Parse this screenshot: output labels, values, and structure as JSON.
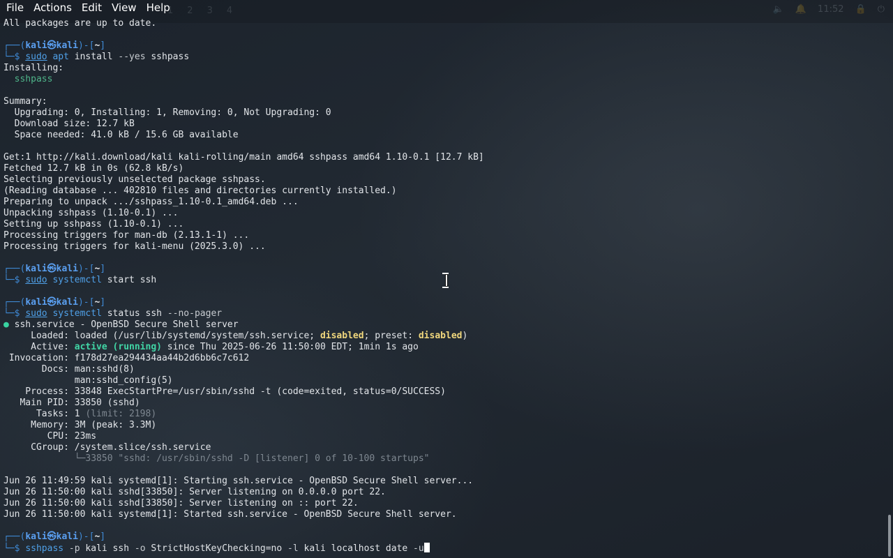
{
  "menu": [
    "File",
    "Actions",
    "Edit",
    "View",
    "Help"
  ],
  "panel": {
    "workspaces": [
      "1",
      "2",
      "3",
      "4"
    ],
    "clock": "11:52"
  },
  "prompt": {
    "user": "kali",
    "host": "kali",
    "dir": "~",
    "at": "㉿"
  },
  "lines": [
    "All packages are up to date.",
    "",
    "Installing:",
    "  sshpass",
    "",
    "Summary:",
    "  Upgrading: 0, Installing: 1, Removing: 0, Not Upgrading: 0",
    "  Download size: 12.7 kB",
    "  Space needed: 41.0 kB / 15.6 GB available",
    "",
    "Get:1 http://kali.download/kali kali-rolling/main amd64 sshpass amd64 1.10-0.1 [12.7 kB]",
    "Fetched 12.7 kB in 0s (62.8 kB/s)",
    "Selecting previously unselected package sshpass.",
    "(Reading database ... 402810 files and directories currently installed.)",
    "Preparing to unpack .../sshpass_1.10-0.1_amd64.deb ...",
    "Unpacking sshpass (1.10-0.1) ...",
    "Setting up sshpass (1.10-0.1) ...",
    "Processing triggers for man-db (2.13.1-1) ...",
    "Processing triggers for kali-menu (2025.3.0) ...",
    "",
    "ssh.service - OpenBSD Secure Shell server",
    "     Loaded: loaded (/usr/lib/systemd/system/ssh.service; ",
    "disabled",
    "; preset: ",
    "disabled",
    ")",
    "     Active: ",
    "active (running)",
    " since Thu 2025-06-26 11:50:00 EDT; 1min 1s ago",
    " Invocation: f178d27ea294434aa44b2d6bb6c7c612",
    "       Docs: man:sshd(8)",
    "             man:sshd_config(5)",
    "    Process: 33848 ExecStartPre=/usr/sbin/sshd -t (code=exited, status=0/SUCCESS)",
    "   Main PID: 33850 (sshd)",
    "      Tasks: 1 ",
    "(limit: 2198)",
    "     Memory: 3M (peak: 3.3M)",
    "        CPU: 23ms",
    "     CGroup: /system.slice/ssh.service",
    "             └─33850 \"sshd: /usr/sbin/sshd -D [listener] 0 of 10-100 startups\"",
    "Jun 26 11:49:59 kali systemd[1]: Starting ssh.service - OpenBSD Secure Shell server...",
    "Jun 26 11:50:00 kali sshd[33850]: Server listening on 0.0.0.0 port 22.",
    "Jun 26 11:50:00 kali sshd[33850]: Server listening on :: port 22.",
    "Jun 26 11:50:00 kali systemd[1]: Started ssh.service - OpenBSD Secure Shell server."
  ],
  "commands": {
    "c1": {
      "sudo": "sudo",
      "bin": "apt",
      "rest": " install ",
      "opt": "--yes",
      "arg": " sshpass"
    },
    "c2": {
      "sudo": "sudo",
      "bin": "systemctl",
      "rest": " start ssh"
    },
    "c3": {
      "sudo": "sudo",
      "bin": "systemctl",
      "rest": " status ssh ",
      "opt": "--no-pager"
    },
    "c4": {
      "bin": "sshpass",
      "p": " -p",
      "a1": " kali ssh",
      "o": " -o",
      "a2": " StrictHostKeyChecking=no",
      "l": " -l",
      "a3": " kali localhost date",
      "u": " -u"
    }
  },
  "prompt_prefix": "┌──(",
  "prompt_mid": ")-[",
  "prompt_end": "]",
  "prompt_line2": "└─$ ",
  "bullet": "●",
  "colors": {
    "prompt": "#3f8ad6",
    "command": "#4fa0e8",
    "active": "#41d6a6",
    "warn": "#f0d77d"
  }
}
